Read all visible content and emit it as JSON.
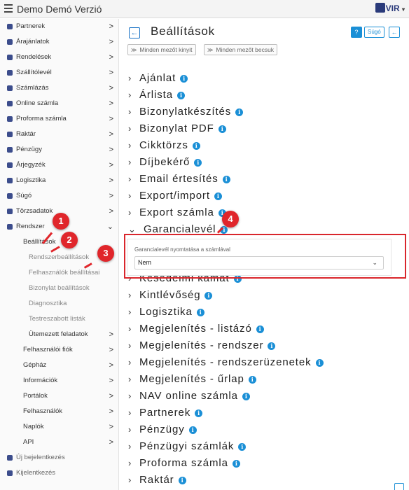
{
  "app": {
    "title": "Demo Demó Verzió",
    "logo": "VIR"
  },
  "sidebar": {
    "items": [
      {
        "label": "Partnerek",
        "chev": ">"
      },
      {
        "label": "Árajánlatok",
        "chev": ">"
      },
      {
        "label": "Rendelések",
        "chev": ">"
      },
      {
        "label": "Szállítólevél",
        "chev": ">"
      },
      {
        "label": "Számlázás",
        "chev": ">"
      },
      {
        "label": "Online számla",
        "chev": ">"
      },
      {
        "label": "Proforma számla",
        "chev": ">"
      },
      {
        "label": "Raktár",
        "chev": ">"
      },
      {
        "label": "Pénzügy",
        "chev": ">"
      },
      {
        "label": "Árjegyzék",
        "chev": ">"
      },
      {
        "label": "Logisztika",
        "chev": ">"
      },
      {
        "label": "Súgó",
        "chev": ">"
      },
      {
        "label": "Törzsadatok",
        "chev": ">"
      },
      {
        "label": "Rendszer",
        "chev": "⌄"
      },
      {
        "label": "Beállítások",
        "chev": ""
      },
      {
        "label": "Rendszerbeállítások",
        "chev": ""
      },
      {
        "label": "Felhasználók beállításai",
        "chev": ""
      },
      {
        "label": "Bizonylat beállítások",
        "chev": ""
      },
      {
        "label": "Diagnosztika",
        "chev": ""
      },
      {
        "label": "Testreszabott listák",
        "chev": ""
      },
      {
        "label": "Ütemezett feladatok",
        "chev": ">"
      },
      {
        "label": "Felhasználói fiók",
        "chev": ">"
      },
      {
        "label": "Gépház",
        "chev": ">"
      },
      {
        "label": "Információk",
        "chev": ">"
      },
      {
        "label": "Portálok",
        "chev": ">"
      },
      {
        "label": "Felhasználók",
        "chev": ">"
      },
      {
        "label": "Naplók",
        "chev": ">"
      },
      {
        "label": "API",
        "chev": ">"
      },
      {
        "label": "Új bejelentkezés",
        "chev": ""
      },
      {
        "label": "Kijelentkezés",
        "chev": ""
      }
    ]
  },
  "header": {
    "back_glyph": "←",
    "title": "Beállítások",
    "help_glyph": "?",
    "sugo": "Súgó",
    "back_small_glyph": "←"
  },
  "toolbar": {
    "expand_icon": "≫",
    "expand": "Minden mezőt kinyit",
    "collapse_icon": "≫",
    "collapse": "Minden mezőt becsuk"
  },
  "sections": [
    {
      "label": "Ajánlat",
      "open": false
    },
    {
      "label": "Árlista",
      "open": false
    },
    {
      "label": "Bizonylatkészítés",
      "open": false
    },
    {
      "label": "Bizonylat PDF",
      "open": false
    },
    {
      "label": "Cikktörzs",
      "open": false
    },
    {
      "label": "Díjbekérő",
      "open": false
    },
    {
      "label": "Email értesítés",
      "open": false
    },
    {
      "label": "Export/import",
      "open": false
    },
    {
      "label": "Export számla",
      "open": false
    },
    {
      "label": "Garancialevél",
      "open": true
    },
    {
      "label": "Késedelmi kamat",
      "open": false
    },
    {
      "label": "Kintlévőség",
      "open": false
    },
    {
      "label": "Logisztika",
      "open": false
    },
    {
      "label": "Megjelenítés - listázó",
      "open": false
    },
    {
      "label": "Megjelenítés - rendszer",
      "open": false
    },
    {
      "label": "Megjelenítés - rendszerüzenetek",
      "open": false
    },
    {
      "label": "Megjelenítés - űrlap",
      "open": false
    },
    {
      "label": "NAV online számla",
      "open": false
    },
    {
      "label": "Partnerek",
      "open": false
    },
    {
      "label": "Pénzügy",
      "open": false
    },
    {
      "label": "Pénzügyi számlák",
      "open": false
    },
    {
      "label": "Proforma számla",
      "open": false
    },
    {
      "label": "Raktár",
      "open": false
    }
  ],
  "garancia_panel": {
    "label": "Garancialevél nyomtatása a számlával",
    "value": "Nem"
  },
  "annotations": [
    "1",
    "2",
    "3",
    "4"
  ],
  "colors": {
    "accent": "#1a8fd6",
    "annotation": "#e0262b",
    "sidebar_icon": "#3c4d8c"
  }
}
